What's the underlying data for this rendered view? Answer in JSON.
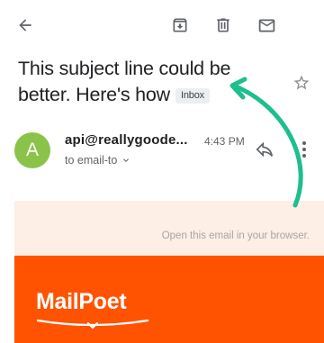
{
  "icons": {
    "back": "arrow-left-icon",
    "archive": "archive-icon",
    "delete": "trash-icon",
    "mark_unread": "mail-icon",
    "star": "star-icon",
    "reply": "reply-icon",
    "more": "more-vertical-icon",
    "expand": "chevron-down-icon"
  },
  "email": {
    "subject": "This subject line could be better. Here's how",
    "label": "Inbox",
    "sender_initial": "A",
    "sender": "api@reallygoode...",
    "time": "4:43 PM",
    "recipient": "to email-to"
  },
  "body": {
    "browser_link": "Open this email in your browser.",
    "logo_text": "MailPoet"
  },
  "colors": {
    "avatar": "#8bc34a",
    "header_bg": "#fdeee6",
    "brand_orange": "#ff5301",
    "annotation_arrow": "#1dbf8e"
  }
}
